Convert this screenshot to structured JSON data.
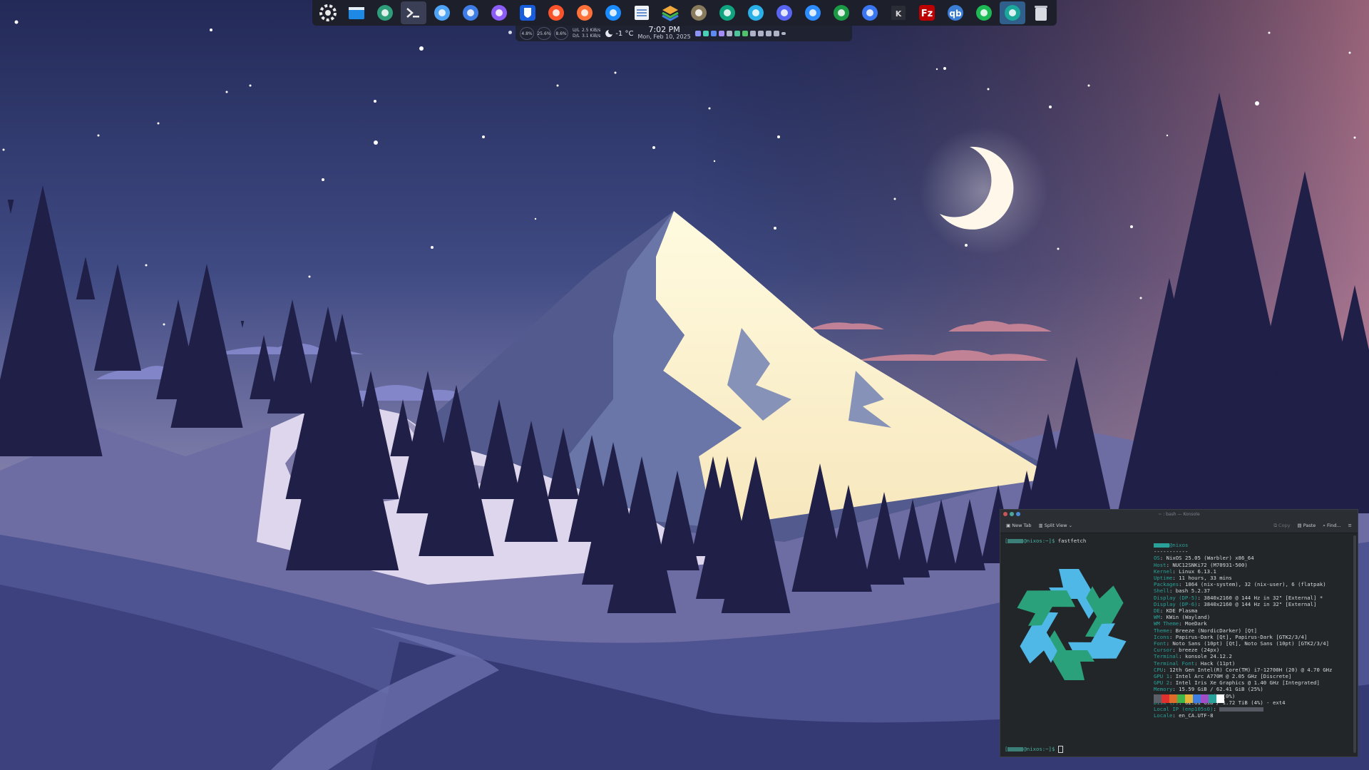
{
  "dock": {
    "apps": [
      {
        "name": "system-settings-icon",
        "color": "#e8e8e8"
      },
      {
        "name": "file-manager-icon",
        "color": "#1e88e5"
      },
      {
        "name": "plugin-app-icon",
        "color": "#2e9e7a"
      },
      {
        "name": "terminal-icon",
        "color": "#eaeaea"
      },
      {
        "name": "kde-discover-icon",
        "color": "#4fa3f7"
      },
      {
        "name": "apps-grid-icon",
        "color": "#3f7de6"
      },
      {
        "name": "obsidian-icon",
        "color": "#8b5cf6"
      },
      {
        "name": "bitwarden-icon",
        "color": "#175ddc"
      },
      {
        "name": "brave-icon",
        "color": "#fb542b"
      },
      {
        "name": "firefox-icon",
        "color": "#ff7139"
      },
      {
        "name": "thunderbird-icon",
        "color": "#1a8cff"
      },
      {
        "name": "notes-icon",
        "color": "#eef2f6"
      },
      {
        "name": "layers-app-icon",
        "color": "#f2a93b"
      },
      {
        "name": "gimp-icon",
        "color": "#8a7a5c"
      },
      {
        "name": "chatgpt-icon",
        "color": "#10a37f"
      },
      {
        "name": "feather-app-icon",
        "color": "#2ab0e8"
      },
      {
        "name": "discord-icon",
        "color": "#5865f2"
      },
      {
        "name": "zoom-icon",
        "color": "#2d8cff"
      },
      {
        "name": "messenger-icon",
        "color": "#1b9a45"
      },
      {
        "name": "signal-icon",
        "color": "#3a76f0"
      },
      {
        "name": "kdenlive-icon",
        "color": "#d6d6d6"
      },
      {
        "name": "filezilla-icon",
        "color": "#bf0000"
      },
      {
        "name": "qbittorrent-icon",
        "color": "#3b7ed6"
      },
      {
        "name": "spotify-icon",
        "color": "#1db954"
      },
      {
        "name": "aperture-app-icon",
        "color": "#1aa89a"
      },
      {
        "name": "trash-icon",
        "color": "#d9dbe2"
      }
    ]
  },
  "status": {
    "cpu": "4.8%",
    "mem": "25.6%",
    "swap": "8.6%",
    "ul_label": "U/L",
    "dl_label": "D/L",
    "ul_rate": "2.5 KiB/s",
    "dl_rate": "3.1 KiB/s",
    "temp": "-1 °C",
    "time": "7:02 PM",
    "date": "Mon, Feb 10, 2025"
  },
  "konsole": {
    "title": "~ : bash — Konsole",
    "toolbar": {
      "new_tab": "New Tab",
      "split_view": "Split View",
      "copy": "Copy",
      "paste": "Paste",
      "find": "Find..."
    },
    "prompt_host": "@nixos:~]$",
    "command": " fastfetch",
    "header_host": "@nixos",
    "separator": "-----------",
    "info": [
      {
        "k": "OS",
        "v": ": NixOS 25.05 (Warbler) x86_64"
      },
      {
        "k": "Host",
        "v": ": NUC12SNKi72 (M70931-500)"
      },
      {
        "k": "Kernel",
        "v": ": Linux 6.13.1"
      },
      {
        "k": "Uptime",
        "v": ": 11 hours, 33 mins"
      },
      {
        "k": "Packages",
        "v": ": 1864 (nix-system), 32 (nix-user), 6 (flatpak)"
      },
      {
        "k": "Shell",
        "v": ": bash 5.2.37"
      },
      {
        "k": "Display (DP-5)",
        "v": ": 3840x2160 @ 144 Hz in 32\" [External] *"
      },
      {
        "k": "Display (DP-6)",
        "v": ": 3840x2160 @ 144 Hz in 32\" [External]"
      },
      {
        "k": "DE",
        "v": ": KDE Plasma"
      },
      {
        "k": "WM",
        "v": ": KWin (Wayland)"
      },
      {
        "k": "WM Theme",
        "v": ": MoeDark"
      },
      {
        "k": "Theme",
        "v": ": Breeze (NordicDarker) [Qt]"
      },
      {
        "k": "Icons",
        "v": ": Papirus-Dark [Qt], Papirus-Dark [GTK2/3/4]"
      },
      {
        "k": "Font",
        "v": ": Noto Sans (10pt) [Qt], Noto Sans (10pt) [GTK2/3/4]"
      },
      {
        "k": "Cursor",
        "v": ": breeze (24px)"
      },
      {
        "k": "Terminal",
        "v": ": konsole 24.12.2"
      },
      {
        "k": "Terminal Font",
        "v": ": Hack (11pt)"
      },
      {
        "k": "CPU",
        "v": ": 12th Gen Intel(R) Core(TM) i7-12700H (20) @ 4.70 GHz"
      },
      {
        "k": "GPU 1",
        "v": ": Intel Arc A770M @ 2.05 GHz [Discrete]"
      },
      {
        "k": "GPU 2",
        "v": ": Intel Iris Xe Graphics @ 1.40 GHz [Integrated]"
      },
      {
        "k": "Memory",
        "v": ": 15.59 GiB / 62.41 GiB (25%)"
      },
      {
        "k": "Swap",
        "v": ": 0 B / 68.64 GiB (0%)"
      },
      {
        "k": "Disk (/)",
        "v": ": 62.81 GiB / 1.72 TiB (4%) - ext4"
      },
      {
        "k": "Local IP (enp105s0)",
        "v": ":"
      },
      {
        "k": "Locale",
        "v": ": en_CA.UTF-8"
      }
    ],
    "palette": [
      "#5b6068",
      "#e0302e",
      "#e06c2a",
      "#3fb54a",
      "#e6b43a",
      "#3d7ee0",
      "#a04dc8",
      "#2aa198",
      "#ffffff"
    ]
  }
}
